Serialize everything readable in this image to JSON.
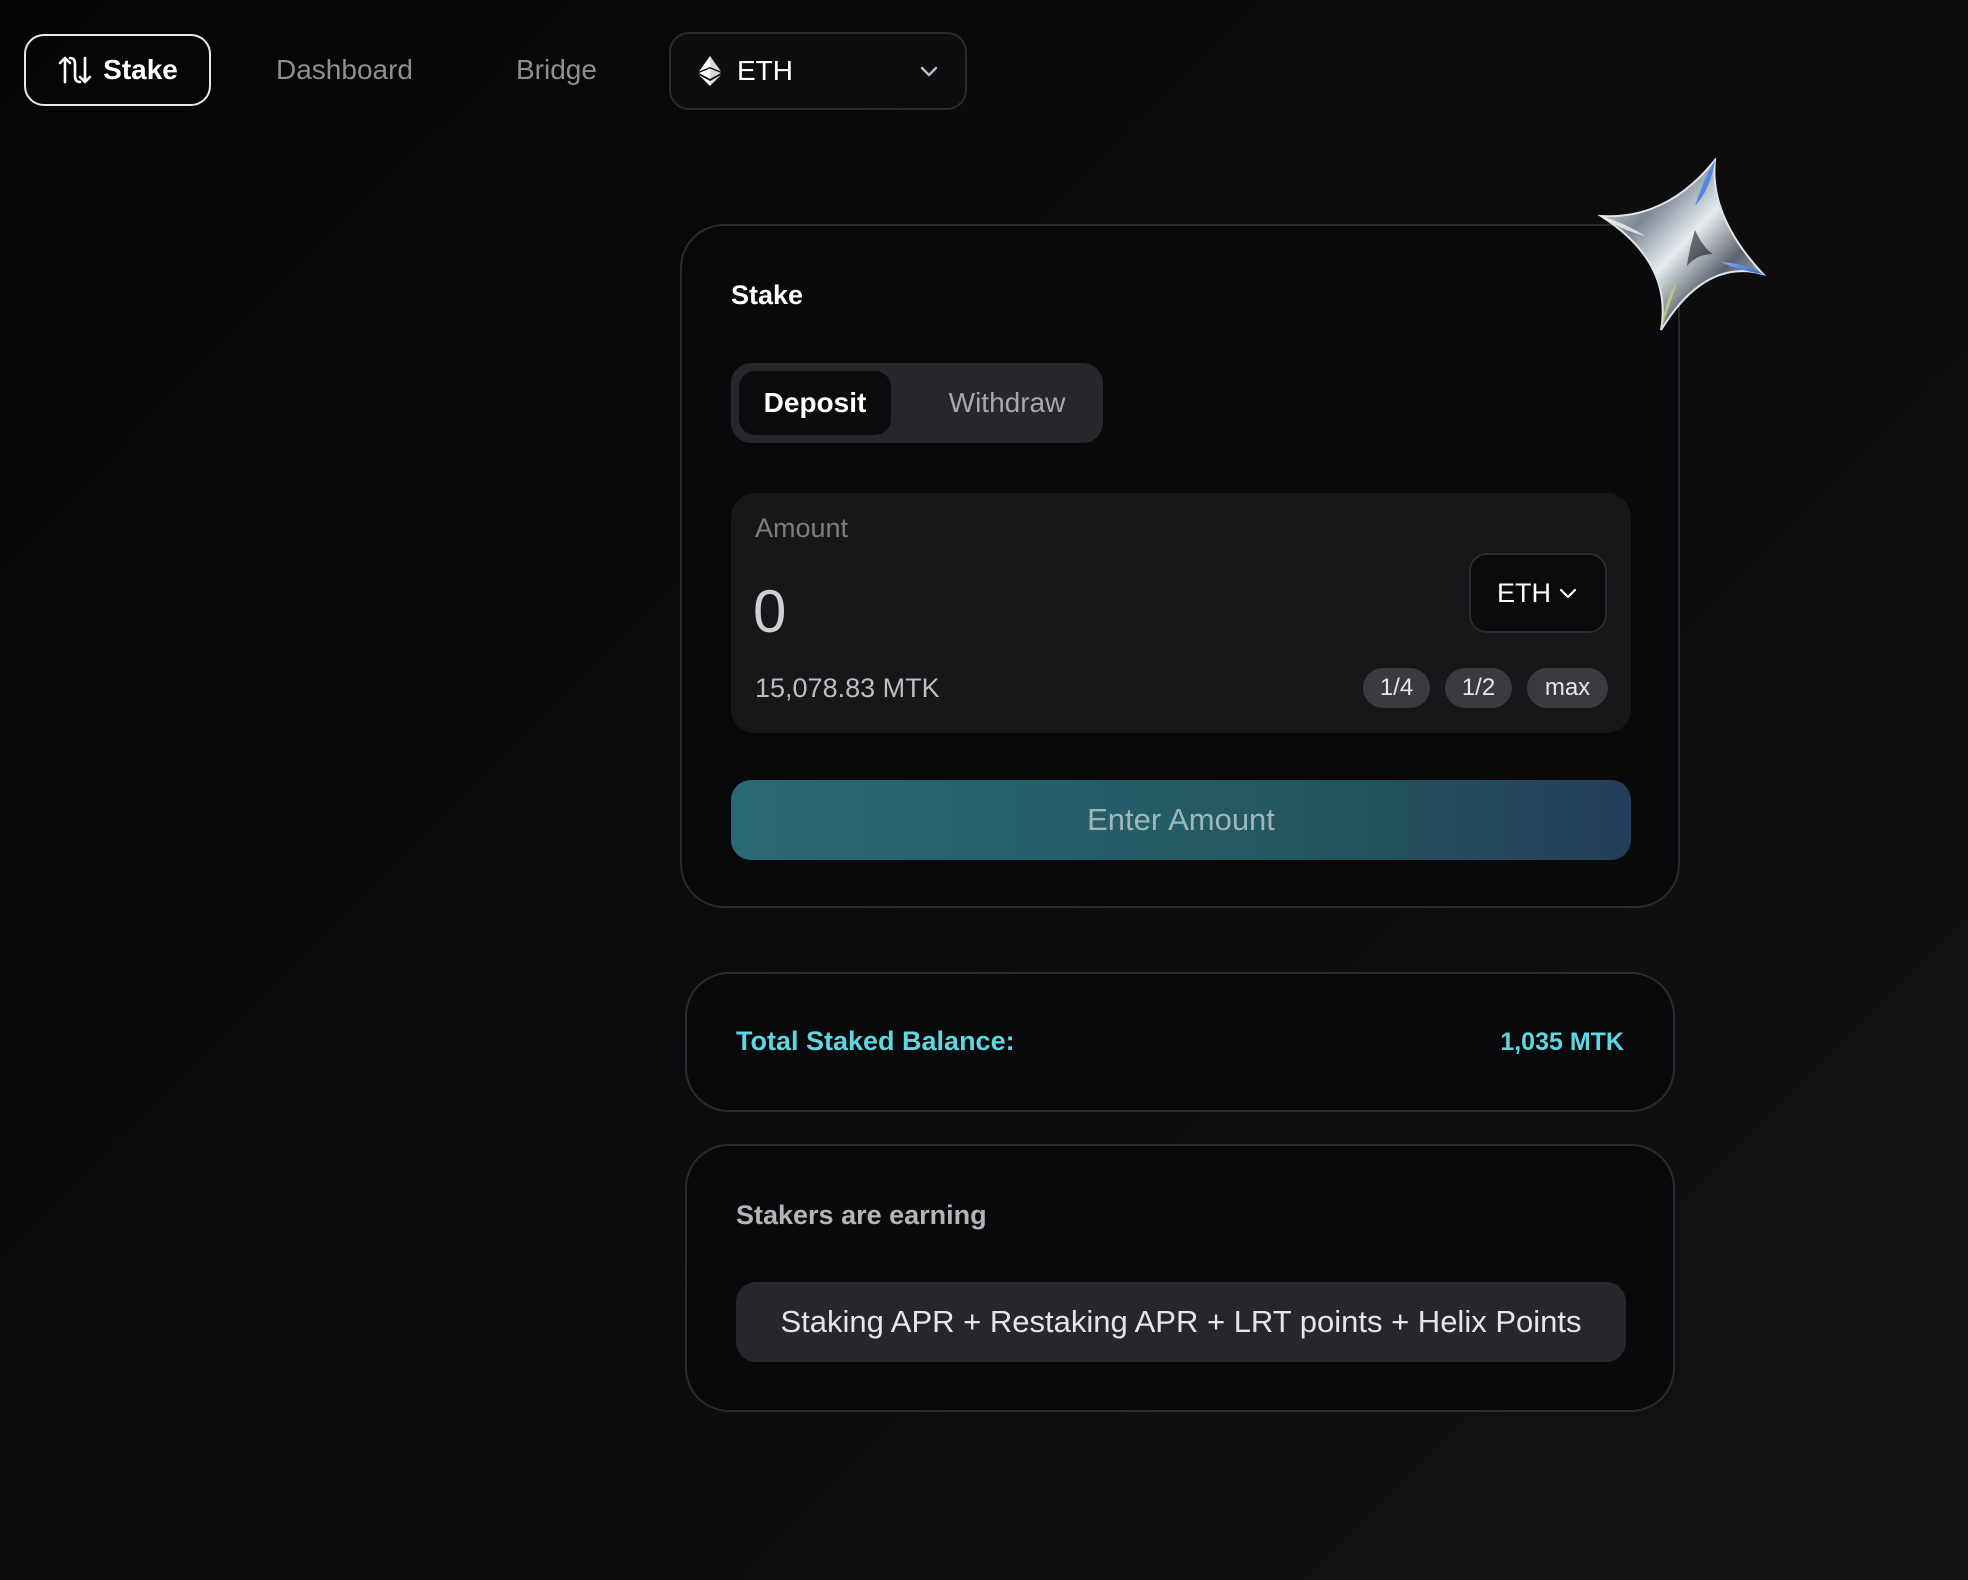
{
  "nav": {
    "stake_label": "Stake",
    "dashboard_label": "Dashboard",
    "bridge_label": "Bridge",
    "network": "ETH"
  },
  "stake_card": {
    "title": "Stake",
    "tabs": {
      "deposit": "Deposit",
      "withdraw": "Withdraw"
    },
    "amount": {
      "label": "Amount",
      "placeholder": "0",
      "token": "ETH",
      "balance": "15,078.83 MTK",
      "quick_quarter": "1/4",
      "quick_half": "1/2",
      "quick_max": "max"
    },
    "submit_label": "Enter Amount"
  },
  "balance_card": {
    "label": "Total Staked Balance:",
    "value": "1,035 MTK"
  },
  "earn_card": {
    "title": "Stakers are earning",
    "tagline": "Staking APR + Restaking APR + LRT points + Helix Points"
  },
  "colors": {
    "accent": "#5fd6e2",
    "background": "#0a0a0b",
    "card_border": "#2a2b2e"
  }
}
